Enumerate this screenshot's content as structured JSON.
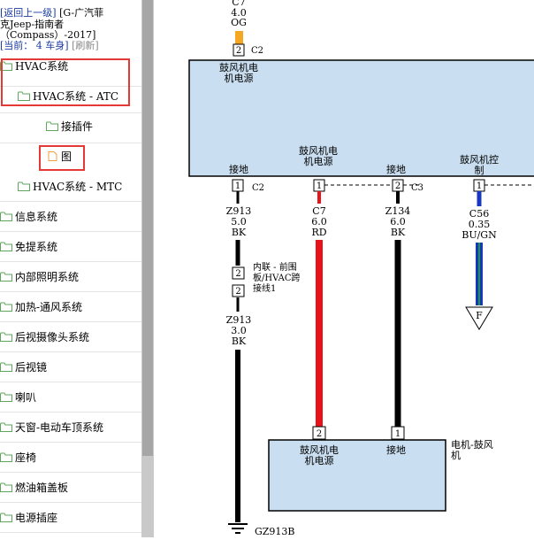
{
  "header": {
    "back_link": "[返回上一级]",
    "model_line1": "[G-广汽菲",
    "model_line2": "克Jeep-指南者",
    "model_line3": "（Compass）-2017]",
    "current_label": "[当前：",
    "current_value": "4 车身]",
    "refresh": "[刷新]"
  },
  "tree": {
    "items": [
      {
        "label": "HVAC系统",
        "icon": "folder-icon"
      },
      {
        "label": "HVAC系统 - ATC",
        "icon": "folder-icon"
      },
      {
        "label": "接插件",
        "icon": "folder-icon"
      },
      {
        "label": "图",
        "icon": "document-icon"
      },
      {
        "label": "HVAC系统 - MTC",
        "icon": "folder-icon"
      },
      {
        "label": "信息系统",
        "icon": "folder-icon"
      },
      {
        "label": "免提系统",
        "icon": "folder-icon"
      },
      {
        "label": "内部照明系统",
        "icon": "folder-icon"
      },
      {
        "label": "加热-通风系统",
        "icon": "folder-icon"
      },
      {
        "label": "后视摄像头系统",
        "icon": "folder-icon"
      },
      {
        "label": "后视镜",
        "icon": "folder-icon"
      },
      {
        "label": "喇叭",
        "icon": "folder-icon"
      },
      {
        "label": "天窗-电动车顶系统",
        "icon": "folder-icon"
      },
      {
        "label": "座椅",
        "icon": "folder-icon"
      },
      {
        "label": "燃油箱盖板",
        "icon": "folder-icon"
      },
      {
        "label": "电源插座",
        "icon": "folder-icon"
      }
    ]
  },
  "diagram": {
    "top_wire": {
      "circuit": "C7",
      "gauge": "4.0",
      "color": "OG"
    },
    "c2_top": {
      "pin": "2",
      "conn": "C2"
    },
    "upper_module": {
      "label_power_1": "鼓风机电",
      "label_power_2": "机电源",
      "label_power2_1": "鼓风机电",
      "label_power2_2": "机电源",
      "label_ground1": "接地",
      "label_ground2": "接地",
      "label_ctrl_1": "鼓风机控",
      "label_ctrl_2": "制"
    },
    "pins_upper": [
      {
        "pin": "1",
        "conn": "C2"
      },
      {
        "pin": "1"
      },
      {
        "pin": "2",
        "conn": "C3"
      },
      {
        "pin": "1"
      }
    ],
    "wires": [
      {
        "circuit": "Z913",
        "gauge": "5.0",
        "color": "BK"
      },
      {
        "circuit": "C7",
        "gauge": "6.0",
        "color": "RD"
      },
      {
        "circuit": "Z134",
        "gauge": "6.0",
        "color": "BK"
      },
      {
        "circuit": "C56",
        "gauge": "0.35",
        "color": "BU/GN"
      }
    ],
    "inline_conn": {
      "pin_a": "2",
      "pin_b": "2",
      "line1": "内联 - 前围",
      "line2": "板/HVAC跨",
      "line3": "接线1"
    },
    "lower_wire": {
      "circuit": "Z913",
      "gauge": "3.0",
      "color": "BK"
    },
    "arrow_label": "F",
    "lower_module": {
      "pin_a": "2",
      "pin_b": "1",
      "label_power_1": "鼓风机电",
      "label_power_2": "机电源",
      "label_ground": "接地",
      "name_1": "电机-鼓风",
      "name_2": "机"
    },
    "ground_label": "GZ913B"
  },
  "colors": {
    "module_fill": "#c9def0",
    "wire_red": "#e8121a",
    "wire_blue": "#1736c4",
    "wire_green": "#1aa02a",
    "pin_orange": "#f5a623",
    "highlight": "#e53935"
  }
}
